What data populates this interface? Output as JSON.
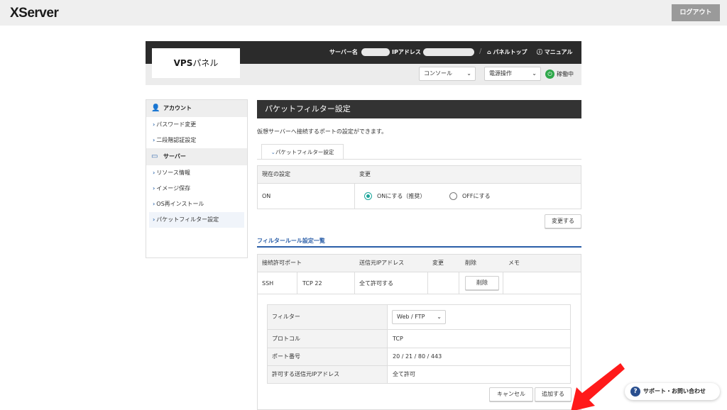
{
  "app": {
    "logo": "XServer",
    "logout": "ログアウト"
  },
  "header": {
    "vps_bold": "VPS",
    "vps_rest": "パネル",
    "server_name_label": "サーバー名",
    "ip_label": "IPアドレス",
    "panel_top": "パネルトップ",
    "manual": "マニュアル",
    "console_select": "コンソール",
    "power_select": "電源操作",
    "status": "稼働中"
  },
  "sidebar": {
    "account_head": "アカウント",
    "account_items": [
      "パスワード変更",
      "二段階認証設定"
    ],
    "server_head": "サーバー",
    "server_items": [
      "リソース情報",
      "イメージ保存",
      "OS再インストール",
      "パケットフィルター設定"
    ]
  },
  "content": {
    "title": "パケットフィルター設定",
    "description": "仮想サーバーへ接続するポートの設定ができます。",
    "tab": "パケットフィルター設定",
    "current_setting_header": "現在の設定",
    "change_header": "変更",
    "current_value": "ON",
    "radio_on": "ONにする（推奨）",
    "radio_off": "OFFにする",
    "change_button": "変更する",
    "rules_title": "フィルタールール設定一覧",
    "rules_headers": [
      "接続許可ポート",
      "送信元IPアドレス",
      "変更",
      "削除",
      "メモ"
    ],
    "rule_row": {
      "name": "SSH",
      "protocol": "TCP 22",
      "source": "全て許可する",
      "delete": "削除"
    },
    "form": {
      "filter_label": "フィルター",
      "filter_value": "Web / FTP",
      "protocol_label": "プロトコル",
      "protocol_value": "TCP",
      "port_label": "ポート番号",
      "port_value": "20 / 21 / 80 / 443",
      "source_label": "許可する送信元IPアドレス",
      "source_value": "全て許可",
      "cancel": "キャンセル",
      "add": "追加する"
    }
  },
  "support": {
    "label": "サポート・お問い合わせ"
  },
  "colors": {
    "accent": "#2a5ea8",
    "radio": "#1aa59a",
    "status_green": "#2ea84a",
    "arrow": "#ff1a1a",
    "header_dark": "#2b2b2b"
  }
}
